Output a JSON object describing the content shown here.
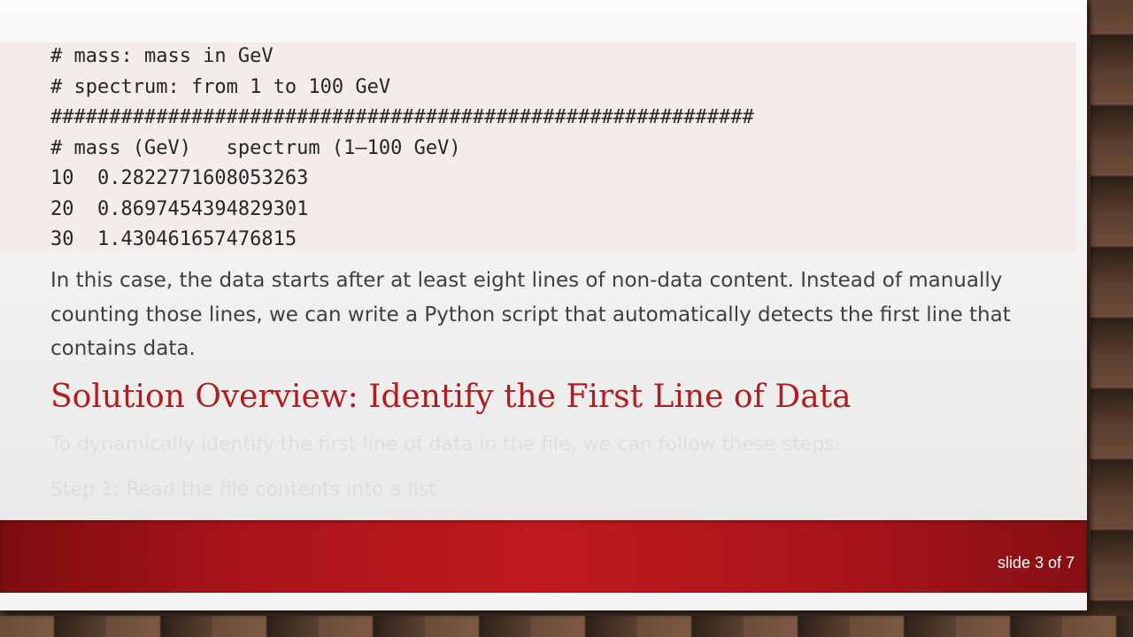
{
  "code_lines": [
    "# mass: mass in GeV",
    "# spectrum: from 1 to 100 GeV",
    "############################################################",
    "# mass (GeV)   spectrum (1–100 GeV)",
    "10  0.2822771608053263",
    "20  0.8697454394829301",
    "30  1.430461657476815"
  ],
  "paragraph": "In this case, the data starts after at least eight lines of non-data content. Instead of manually counting those lines, we can write a Python script that automatically detects the first line that contains data.",
  "heading": "Solution Overview: Identify the First Line of Data",
  "faded_lines": [
    "To dynamically identify the first line of data in the file, we can follow these steps:",
    "Step 1: Read the file contents into a list"
  ],
  "footer": {
    "slide_number": "slide 3 of 7"
  },
  "colors": {
    "heading": "#b01e20",
    "footer_bar": "#c01a1e",
    "code_background": "#f4ecea"
  }
}
